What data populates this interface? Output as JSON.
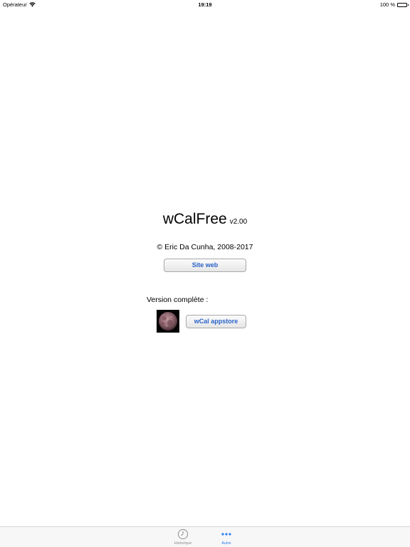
{
  "status_bar": {
    "carrier": "Opérateur",
    "time": "19:19",
    "battery": "100 %",
    "battery_level": 1.0
  },
  "about": {
    "app_name": "wCalFree",
    "version": "v2.00",
    "copyright": "© Eric Da Cunha, 2008-2017",
    "website_button_label": "Site web",
    "full_version_label": "Version complète :",
    "appstore_button_label": "wCal appstore"
  },
  "tab_bar": {
    "items": [
      {
        "label": "Historique",
        "icon": "clock-icon",
        "selected": false
      },
      {
        "label": "Autre",
        "icon": "more-dots-icon",
        "selected": true
      }
    ]
  },
  "colors": {
    "accent": "#2a7cf6",
    "button_text": "#2a62c9",
    "inactive_tab": "#8e8e8e"
  }
}
